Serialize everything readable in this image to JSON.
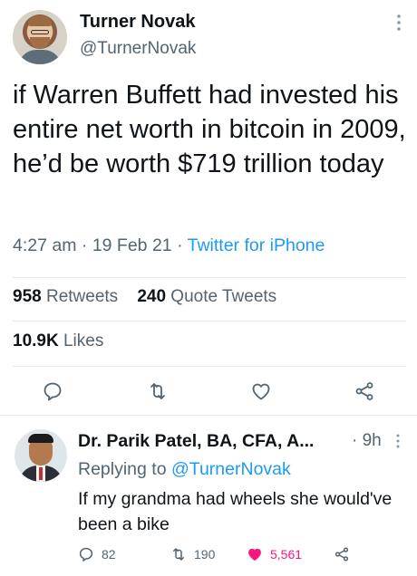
{
  "tweet": {
    "author_name": "Turner Novak",
    "author_handle": "@TurnerNovak",
    "text": "if Warren Buffett had invested his entire net worth in bitcoin in 2009, he’d be worth $719 trillion today",
    "time": "4:27 am",
    "date": "19 Feb 21",
    "source": "Twitter for iPhone",
    "retweets_count": "958",
    "retweets_label": "Retweets",
    "quote_count": "240",
    "quote_label": "Quote Tweets",
    "likes_count": "10.9K",
    "likes_label": "Likes"
  },
  "reply": {
    "author_name": "Dr. Parik Patel, BA, CFA, A...",
    "time": "· 9h",
    "replying_prefix": "Replying to",
    "replying_handle": "@TurnerNovak",
    "text": "If my grandma had wheels she would've been a bike",
    "reply_count": "82",
    "retweet_count": "190",
    "like_count": "5,561"
  },
  "icons": {
    "reply": "reply-icon",
    "retweet": "retweet-icon",
    "like": "heart-icon",
    "share": "share-icon",
    "more": "more-vertical-icon"
  },
  "colors": {
    "link": "#1d9bf0",
    "secondary_text": "#536471",
    "like": "#f91880"
  }
}
